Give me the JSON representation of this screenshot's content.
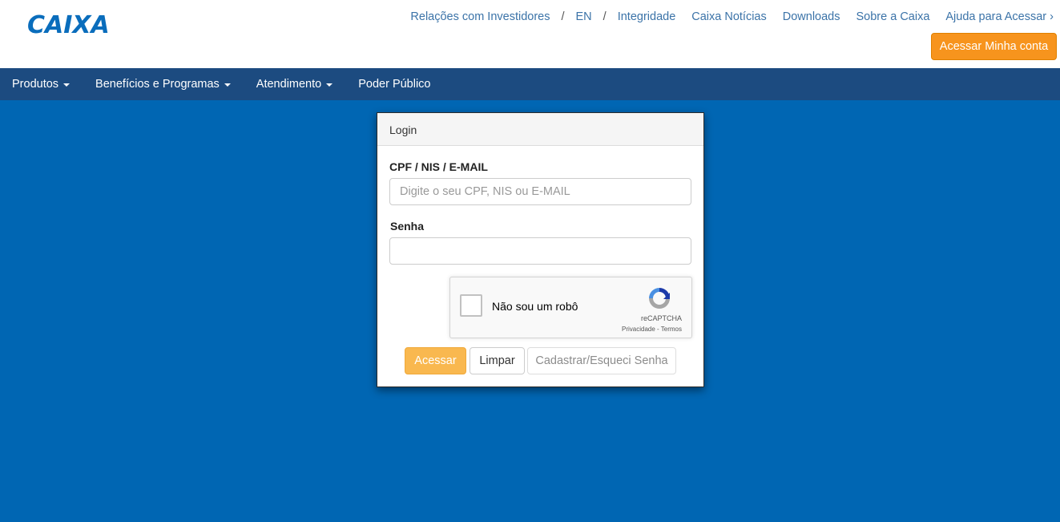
{
  "brand": {
    "logo_text": "CAIXA",
    "logo_color": "#0a6dbc",
    "accent_color": "#f39200"
  },
  "toplinks": {
    "investidores": "Relações com Investidores",
    "separator": "/",
    "en": "EN",
    "integridade": "Integridade",
    "noticias": "Caixa Notícias",
    "downloads": "Downloads",
    "sobre": "Sobre a Caixa",
    "ajuda": "Ajuda para Acessar ›"
  },
  "header": {
    "account_button": "Acessar Minha conta"
  },
  "nav": {
    "items": [
      {
        "label": "Produtos",
        "has_dropdown": true
      },
      {
        "label": "Benefícios e Programas",
        "has_dropdown": true
      },
      {
        "label": "Atendimento",
        "has_dropdown": true
      },
      {
        "label": "Poder Público",
        "has_dropdown": false
      }
    ]
  },
  "login": {
    "title": "Login",
    "user_label": "CPF / NIS / E-MAIL",
    "user_placeholder": "Digite o seu CPF, NIS ou E-MAIL",
    "user_value": "",
    "password_label": "Senha",
    "password_value": "",
    "recaptcha": {
      "label": "Não sou um robô",
      "brand": "reCAPTCHA",
      "terms": "Privacidade - Termos",
      "checked": false
    },
    "buttons": {
      "submit": "Acessar",
      "clear": "Limpar",
      "register": "Cadastrar/Esqueci Senha"
    }
  },
  "colors": {
    "page_background": "#0066b3",
    "navbar": "#1c4b80",
    "primary_button": "#f7941d",
    "link": "#3b73a8"
  }
}
